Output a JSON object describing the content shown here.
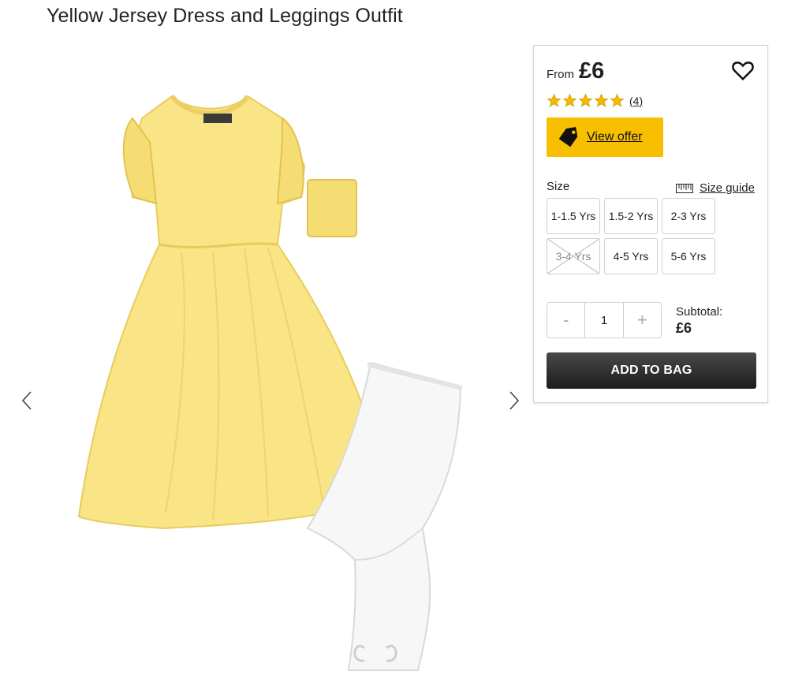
{
  "product": {
    "title": "Yellow Jersey Dress and Leggings Outfit"
  },
  "gallery": {
    "image_alt": "Yellow jersey dress with frill sleeves and white leggings"
  },
  "pricing": {
    "from_label": "From",
    "price": "£6"
  },
  "rating": {
    "stars": 5,
    "count_label": "(4)"
  },
  "offer": {
    "label": "View offer"
  },
  "size": {
    "label": "Size",
    "guide_label": "Size guide",
    "options": [
      {
        "label": "1-1.5 Yrs",
        "available": true
      },
      {
        "label": "1.5-2 Yrs",
        "available": true
      },
      {
        "label": "2-3 Yrs",
        "available": true
      },
      {
        "label": "3-4 Yrs",
        "available": false
      },
      {
        "label": "4-5 Yrs",
        "available": true
      },
      {
        "label": "5-6 Yrs",
        "available": true
      }
    ]
  },
  "quantity": {
    "minus": "-",
    "value": "1",
    "plus": "+"
  },
  "subtotal": {
    "label": "Subtotal:",
    "value": "£6"
  },
  "cart": {
    "add_label": "ADD TO BAG"
  },
  "colors": {
    "accent_yellow": "#f8bf00",
    "star": "#f5b800",
    "button_dark": "#2a2a2a"
  },
  "icons": [
    "chevron-left-icon",
    "chevron-right-icon",
    "heart-icon",
    "star-icon",
    "price-tag-icon",
    "ruler-icon"
  ]
}
